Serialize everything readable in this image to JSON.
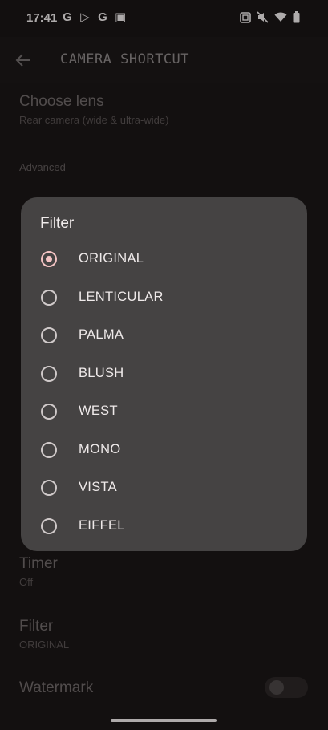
{
  "status_bar": {
    "time": "17:41",
    "left_icons": [
      "G",
      "▷",
      "G",
      "▣"
    ],
    "right_icons": [
      "nfc-icon",
      "mute-icon",
      "wifi-icon",
      "battery-icon"
    ]
  },
  "app_bar": {
    "title": "CAMERA SHORTCUT"
  },
  "settings": {
    "choose_lens": {
      "title": "Choose lens",
      "summary": "Rear camera (wide & ultra-wide)"
    },
    "advanced_header": "Advanced",
    "timer": {
      "title": "Timer",
      "summary": "Off"
    },
    "filter": {
      "title": "Filter",
      "summary": "ORIGINAL"
    },
    "watermark": {
      "title": "Watermark",
      "enabled": false
    }
  },
  "dialog": {
    "title": "Filter",
    "selected": "ORIGINAL",
    "options": [
      {
        "label": "ORIGINAL",
        "checked": true
      },
      {
        "label": "LENTICULAR",
        "checked": false
      },
      {
        "label": "PALMA",
        "checked": false
      },
      {
        "label": "BLUSH",
        "checked": false
      },
      {
        "label": "WEST",
        "checked": false
      },
      {
        "label": "MONO",
        "checked": false
      },
      {
        "label": "VISTA",
        "checked": false
      },
      {
        "label": "EIFFEL",
        "checked": false
      }
    ]
  },
  "colors": {
    "background": "#1a1616",
    "dialog": "#454343",
    "accent": "#f3c3c3"
  }
}
